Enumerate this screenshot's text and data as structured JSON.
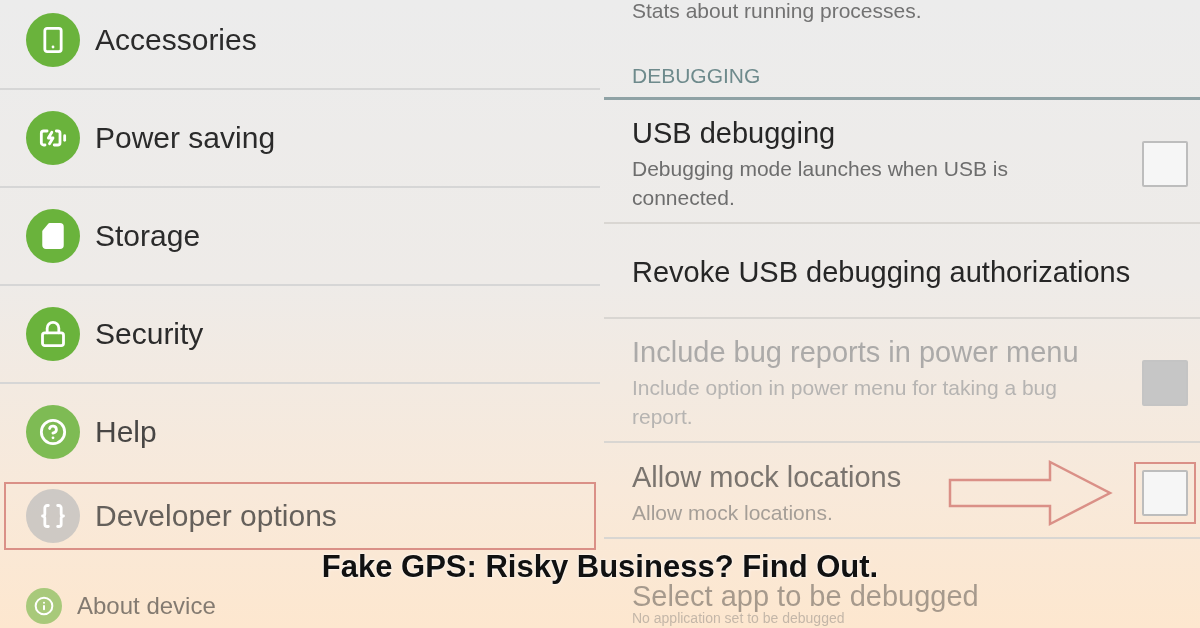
{
  "settings_menu": {
    "items": [
      {
        "label": "Accessories",
        "highlighted": false
      },
      {
        "label": "Power saving",
        "highlighted": false
      },
      {
        "label": "Storage",
        "highlighted": false
      },
      {
        "label": "Security",
        "highlighted": false
      },
      {
        "label": "Help",
        "highlighted": false
      },
      {
        "label": "Developer options",
        "highlighted": true
      },
      {
        "label": "About device",
        "highlighted": false
      }
    ]
  },
  "developer_options": {
    "partial_row": {
      "summary": "Stats about running processes."
    },
    "section_header": "DEBUGGING",
    "rows": [
      {
        "kind": "checkbox",
        "title": "USB debugging",
        "summary": "Debugging mode launches when USB is connected.",
        "checked": false,
        "disabled": false,
        "highlighted": false
      },
      {
        "kind": "action",
        "title": "Revoke USB debugging authorizations",
        "disabled": false,
        "highlighted": false
      },
      {
        "kind": "checkbox",
        "title": "Include bug reports in power menu",
        "summary": "Include option in power menu for taking a bug report.",
        "checked": false,
        "disabled": true,
        "highlighted": false
      },
      {
        "kind": "checkbox",
        "title": "Allow mock locations",
        "summary": "Allow mock locations.",
        "checked": false,
        "disabled": false,
        "highlighted": true
      },
      {
        "kind": "action",
        "title": "Select app to be debugged",
        "summary": "No application set to be debugged",
        "disabled": false,
        "highlighted": false
      }
    ]
  },
  "caption": "Fake GPS: Risky Business? Find Out."
}
